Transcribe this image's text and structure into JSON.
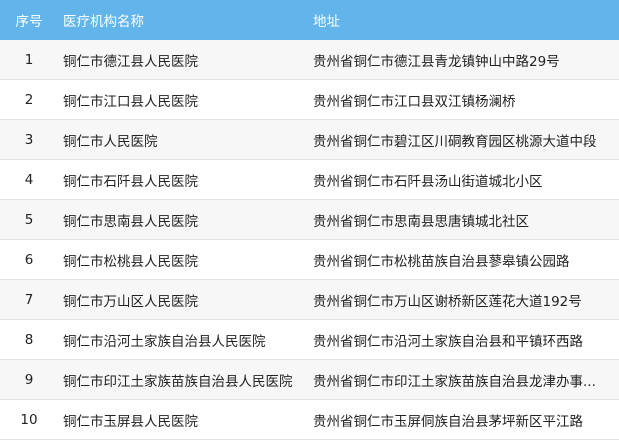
{
  "table": {
    "headers": {
      "index": "序号",
      "name": "医疗机构名称",
      "address": "地址"
    },
    "rows": [
      {
        "index": "1",
        "name": "铜仁市德江县人民医院",
        "address": "贵州省铜仁市德江县青龙镇钟山中路29号"
      },
      {
        "index": "2",
        "name": "铜仁市江口县人民医院",
        "address": "贵州省铜仁市江口县双江镇杨澜桥"
      },
      {
        "index": "3",
        "name": "铜仁市人民医院",
        "address": "贵州省铜仁市碧江区川硐教育园区桃源大道中段"
      },
      {
        "index": "4",
        "name": "铜仁市石阡县人民医院",
        "address": "贵州省铜仁市石阡县汤山街道城北小区"
      },
      {
        "index": "5",
        "name": "铜仁市思南县人民医院",
        "address": "贵州省铜仁市思南县思唐镇城北社区"
      },
      {
        "index": "6",
        "name": "铜仁市松桃县人民医院",
        "address": "贵州省铜仁市松桃苗族自治县蓼皋镇公园路"
      },
      {
        "index": "7",
        "name": "铜仁市万山区人民医院",
        "address": "贵州省铜仁市万山区谢桥新区莲花大道192号"
      },
      {
        "index": "8",
        "name": "铜仁市沿河土家族自治县人民医院",
        "address": "贵州省铜仁市沿河土家族自治县和平镇环西路"
      },
      {
        "index": "9",
        "name": "铜仁市印江土家族苗族自治县人民医院",
        "address": "贵州省铜仁市印江土家族苗族自治县龙津办事..."
      },
      {
        "index": "10",
        "name": "铜仁市玉屏县人民医院",
        "address": "贵州省铜仁市玉屏侗族自治县茅坪新区平江路"
      }
    ]
  },
  "colors": {
    "header_bg": "#62b5ea",
    "header_text": "#ffffff",
    "row_alt_bg": "#f7f7f7",
    "row_bg": "#ffffff"
  }
}
